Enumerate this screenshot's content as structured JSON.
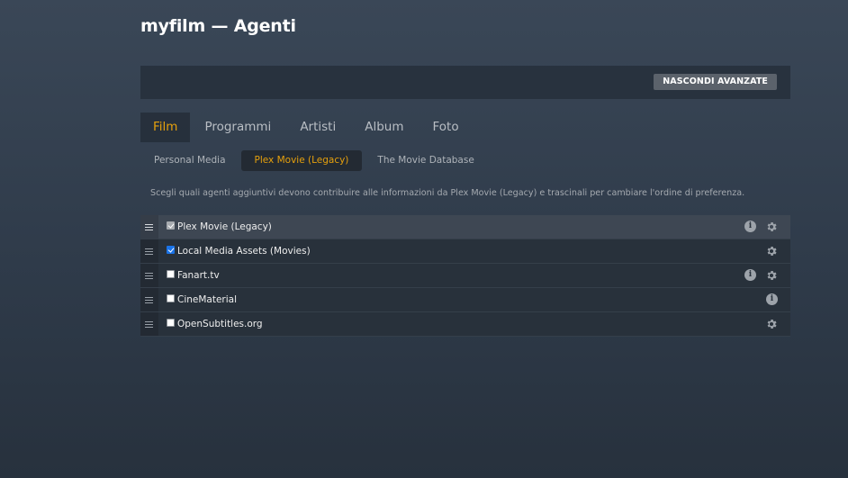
{
  "header": {
    "title": "myfilm — Agenti"
  },
  "toolbar": {
    "advanced_button": "NASCONDI AVANZATE"
  },
  "main_tabs": [
    {
      "label": "Film",
      "active": true
    },
    {
      "label": "Programmi",
      "active": false
    },
    {
      "label": "Artisti",
      "active": false
    },
    {
      "label": "Album",
      "active": false
    },
    {
      "label": "Foto",
      "active": false
    }
  ],
  "sub_tabs": [
    {
      "label": "Personal Media",
      "active": false
    },
    {
      "label": "Plex Movie (Legacy)",
      "active": true
    },
    {
      "label": "The Movie Database",
      "active": false
    }
  ],
  "description": "Scegli quali agenti aggiuntivi devono contribuire alle informazioni da Plex Movie (Legacy) e trascinali per cambiare l'ordine di preferenza.",
  "agents": [
    {
      "name": "Plex Movie (Legacy)",
      "checked": true,
      "disabled": true,
      "info": true,
      "settings": true
    },
    {
      "name": "Local Media Assets (Movies)",
      "checked": true,
      "disabled": false,
      "info": false,
      "settings": true
    },
    {
      "name": "Fanart.tv",
      "checked": false,
      "disabled": false,
      "info": true,
      "settings": true
    },
    {
      "name": "CineMaterial",
      "checked": false,
      "disabled": false,
      "info": true,
      "settings": false
    },
    {
      "name": "OpenSubtitles.org",
      "checked": false,
      "disabled": false,
      "info": false,
      "settings": true
    }
  ],
  "icons": {
    "drag": "drag-handle-icon",
    "info": "info-icon",
    "settings": "gear-icon",
    "info_glyph": "i"
  },
  "colors": {
    "accent": "#e5a00d",
    "checkbox": "#1a73e8"
  }
}
